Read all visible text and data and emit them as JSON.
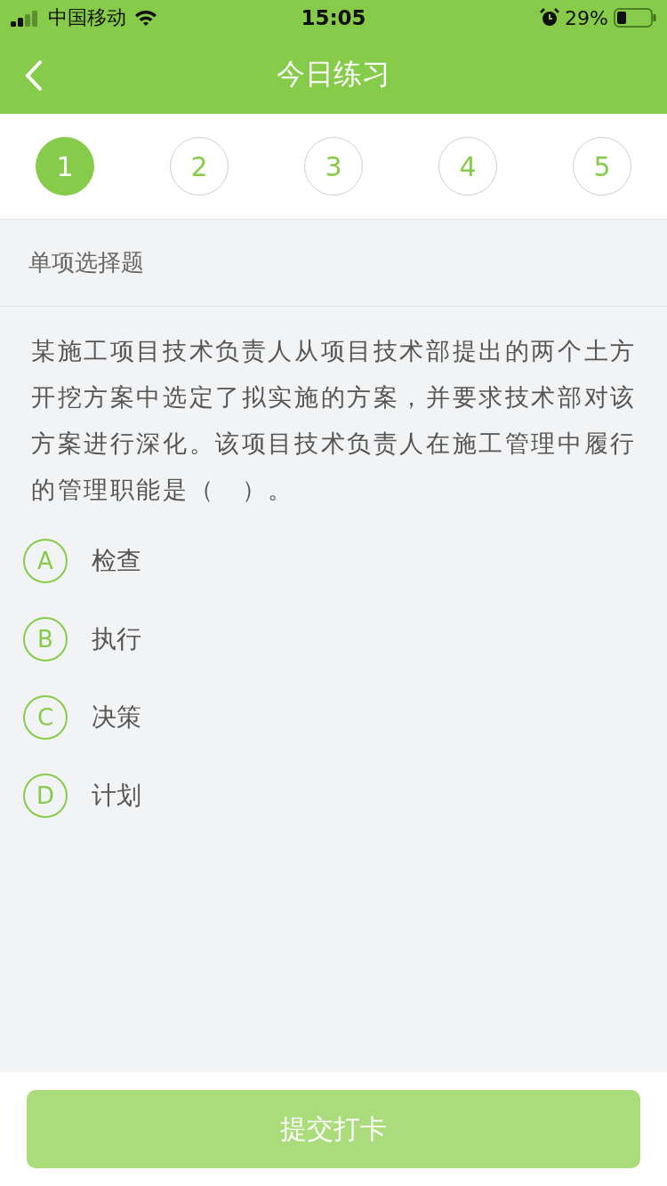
{
  "status_bar": {
    "carrier": "中国移动",
    "time": "15:05",
    "battery": "29%"
  },
  "header": {
    "title": "今日练习"
  },
  "question_numbers": [
    {
      "label": "1",
      "selected": true
    },
    {
      "label": "2",
      "selected": false
    },
    {
      "label": "3",
      "selected": false
    },
    {
      "label": "4",
      "selected": false
    },
    {
      "label": "5",
      "selected": false
    }
  ],
  "section_label": "单项选择题",
  "question": "某施工项目技术负责人从项目技术部提出的两个土方开挖方案中选定了拟实施的方案，并要求技术部对该方案进行深化。该项目技术负责人在施工管理中履行的管理职能是（　）。",
  "options": [
    {
      "letter": "A",
      "text": "检查",
      "selected": false
    },
    {
      "letter": "B",
      "text": "执行",
      "selected": false
    },
    {
      "letter": "C",
      "text": "决策",
      "selected": false
    },
    {
      "letter": "D",
      "text": "计划",
      "selected": false
    }
  ],
  "submit_button": {
    "label": "提交打卡",
    "disabled": true
  }
}
